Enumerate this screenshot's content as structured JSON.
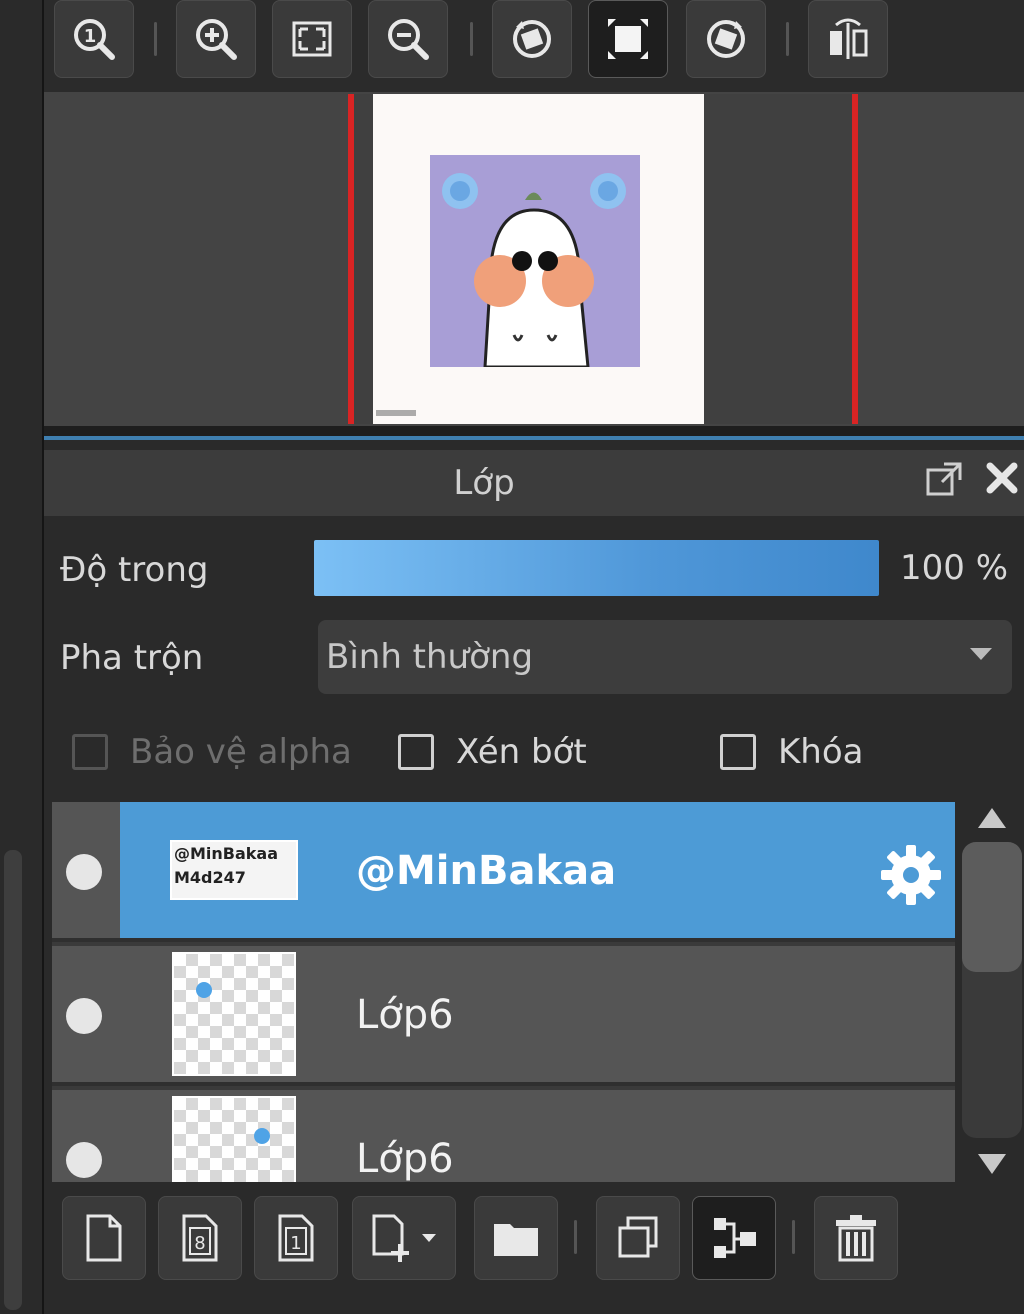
{
  "navigator": {
    "tools": [
      {
        "name": "zoom-actual-icon"
      },
      {
        "name": "zoom-in-icon"
      },
      {
        "name": "fit-screen-icon"
      },
      {
        "name": "zoom-out-icon"
      },
      {
        "name": "rotate-left-icon"
      },
      {
        "name": "fit-canvas-icon"
      },
      {
        "name": "rotate-right-icon"
      },
      {
        "name": "flip-horizontal-icon"
      }
    ],
    "active_tool": "fit-canvas-icon"
  },
  "layer_panel": {
    "title": "Lớp",
    "opacity_label": "Độ trong",
    "opacity_value": "100 %",
    "opacity_fraction": 1.0,
    "blend_label": "Pha trộn",
    "blend_mode": "Bình thường",
    "checkboxes": {
      "protect_alpha": {
        "label": "Bảo vệ alpha",
        "checked": false,
        "enabled": false
      },
      "clipping": {
        "label": "Xén bớt",
        "checked": false,
        "enabled": true
      },
      "lock": {
        "label": "Khóa",
        "checked": false,
        "enabled": true
      }
    },
    "layers": [
      {
        "name": "@MinBakaa",
        "thumb_text": [
          "@MinBakaa",
          "M4d247"
        ],
        "selected": true
      },
      {
        "name": "Lớp6",
        "selected": false
      },
      {
        "name": "Lớp6",
        "selected": false
      }
    ]
  },
  "bottom_tools": [
    {
      "name": "new-layer-icon"
    },
    {
      "name": "new-8bit-layer-icon"
    },
    {
      "name": "new-1bit-layer-icon"
    },
    {
      "name": "add-layer-dropdown-icon"
    },
    {
      "name": "new-folder-icon"
    },
    {
      "name": "duplicate-layer-icon"
    },
    {
      "name": "merge-down-icon"
    },
    {
      "name": "delete-layer-icon"
    }
  ],
  "colors": {
    "accent": "#4d9bd6",
    "canvas_border": "#d92424",
    "artwork_bg": "#a89ed6"
  }
}
